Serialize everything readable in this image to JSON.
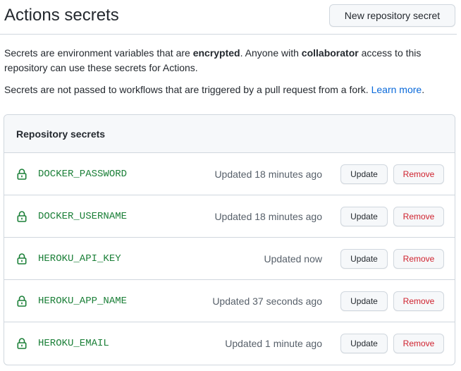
{
  "header": {
    "title": "Actions secrets",
    "new_secret_label": "New repository secret"
  },
  "intro": {
    "p1_a": "Secrets are environment variables that are ",
    "p1_b": "encrypted",
    "p1_c": ". Anyone with ",
    "p1_d": "collaborator",
    "p1_e": " access to this repository can use these secrets for Actions.",
    "p2_a": "Secrets are not passed to workflows that are triggered by a pull request from a fork. ",
    "p2_link": "Learn more",
    "p2_b": "."
  },
  "secrets_box": {
    "title": "Repository secrets",
    "update_label": "Update",
    "remove_label": "Remove",
    "items": [
      {
        "name": "DOCKER_PASSWORD",
        "updated": "Updated 18 minutes ago"
      },
      {
        "name": "DOCKER_USERNAME",
        "updated": "Updated 18 minutes ago"
      },
      {
        "name": "HEROKU_API_KEY",
        "updated": "Updated now"
      },
      {
        "name": "HEROKU_APP_NAME",
        "updated": "Updated 37 seconds ago"
      },
      {
        "name": "HEROKU_EMAIL",
        "updated": "Updated 1 minute ago"
      }
    ]
  },
  "icons": {
    "secret": "lock-icon"
  },
  "colors": {
    "secret_name": "#1a7f37",
    "link": "#0969da",
    "danger": "#cf222e"
  }
}
